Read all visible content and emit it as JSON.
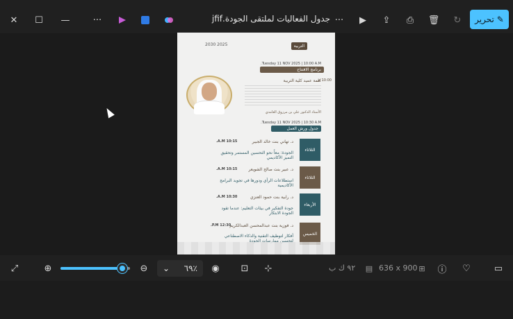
{
  "window": {
    "title": "جدول الفعاليات لملتقى الجودة.jfif",
    "edit_label": "تحرير"
  },
  "poster": {
    "year_logos": "2030 2025",
    "faculty": "التربية",
    "date1": "Tuesday 11 NOV 2025 | 10:00 A.M.",
    "opening": "برنامج الافتتاح",
    "time_opening": "10:00 ص",
    "dean_word": "كلمة عميد كلية التربية",
    "dean_name": "الأستاذ الدكتور علي بن مرزوق الغامدي",
    "date2": "Tuesday 11 NOV 2025 | 10:30 A.M.",
    "workshops": "جدول ورش العمل",
    "sessions": [
      {
        "time": "10:15 A.M.",
        "name": "د. تهاني بنت خالد الجبير",
        "title": "الجودة: معاً نحو التحسين المستمر وتحقيق التميز الأكاديمي",
        "day": "الثلاثاء",
        "color": "teal"
      },
      {
        "time": "10:15 A.M.",
        "name": "د. عبير بنت صالح الشويعر",
        "title": "استطلاعات الرأي ودورها في تجويد البرامج الأكاديمية",
        "day": "الثلاثاء",
        "color": "brown"
      },
      {
        "time": "10:30 A.M.",
        "name": "د. رابية بنت حمود العنزي",
        "title": "جودة التفكير في بيئات التعليم: عندما تقود الجودة الابتكار",
        "day": "الأربعاء",
        "color": "teal"
      },
      {
        "time": "12:30 P.M.",
        "name": "د. فوزية بنت عبدالمحسن العبدالكريم",
        "title": "أفكار لتوظيف التقنية والذكاء الاصطناعي لتحسين ممارسات الجودة",
        "day": "الخميس",
        "color": "brown"
      }
    ]
  },
  "bottombar": {
    "zoom_value": "٦٩٪",
    "file_size": "٩٢ ك ب",
    "dimensions": "636 x 900"
  },
  "colors": {
    "accent": "#4cc2ff",
    "teal": "#2f5c66",
    "brown": "#6b5a48"
  }
}
